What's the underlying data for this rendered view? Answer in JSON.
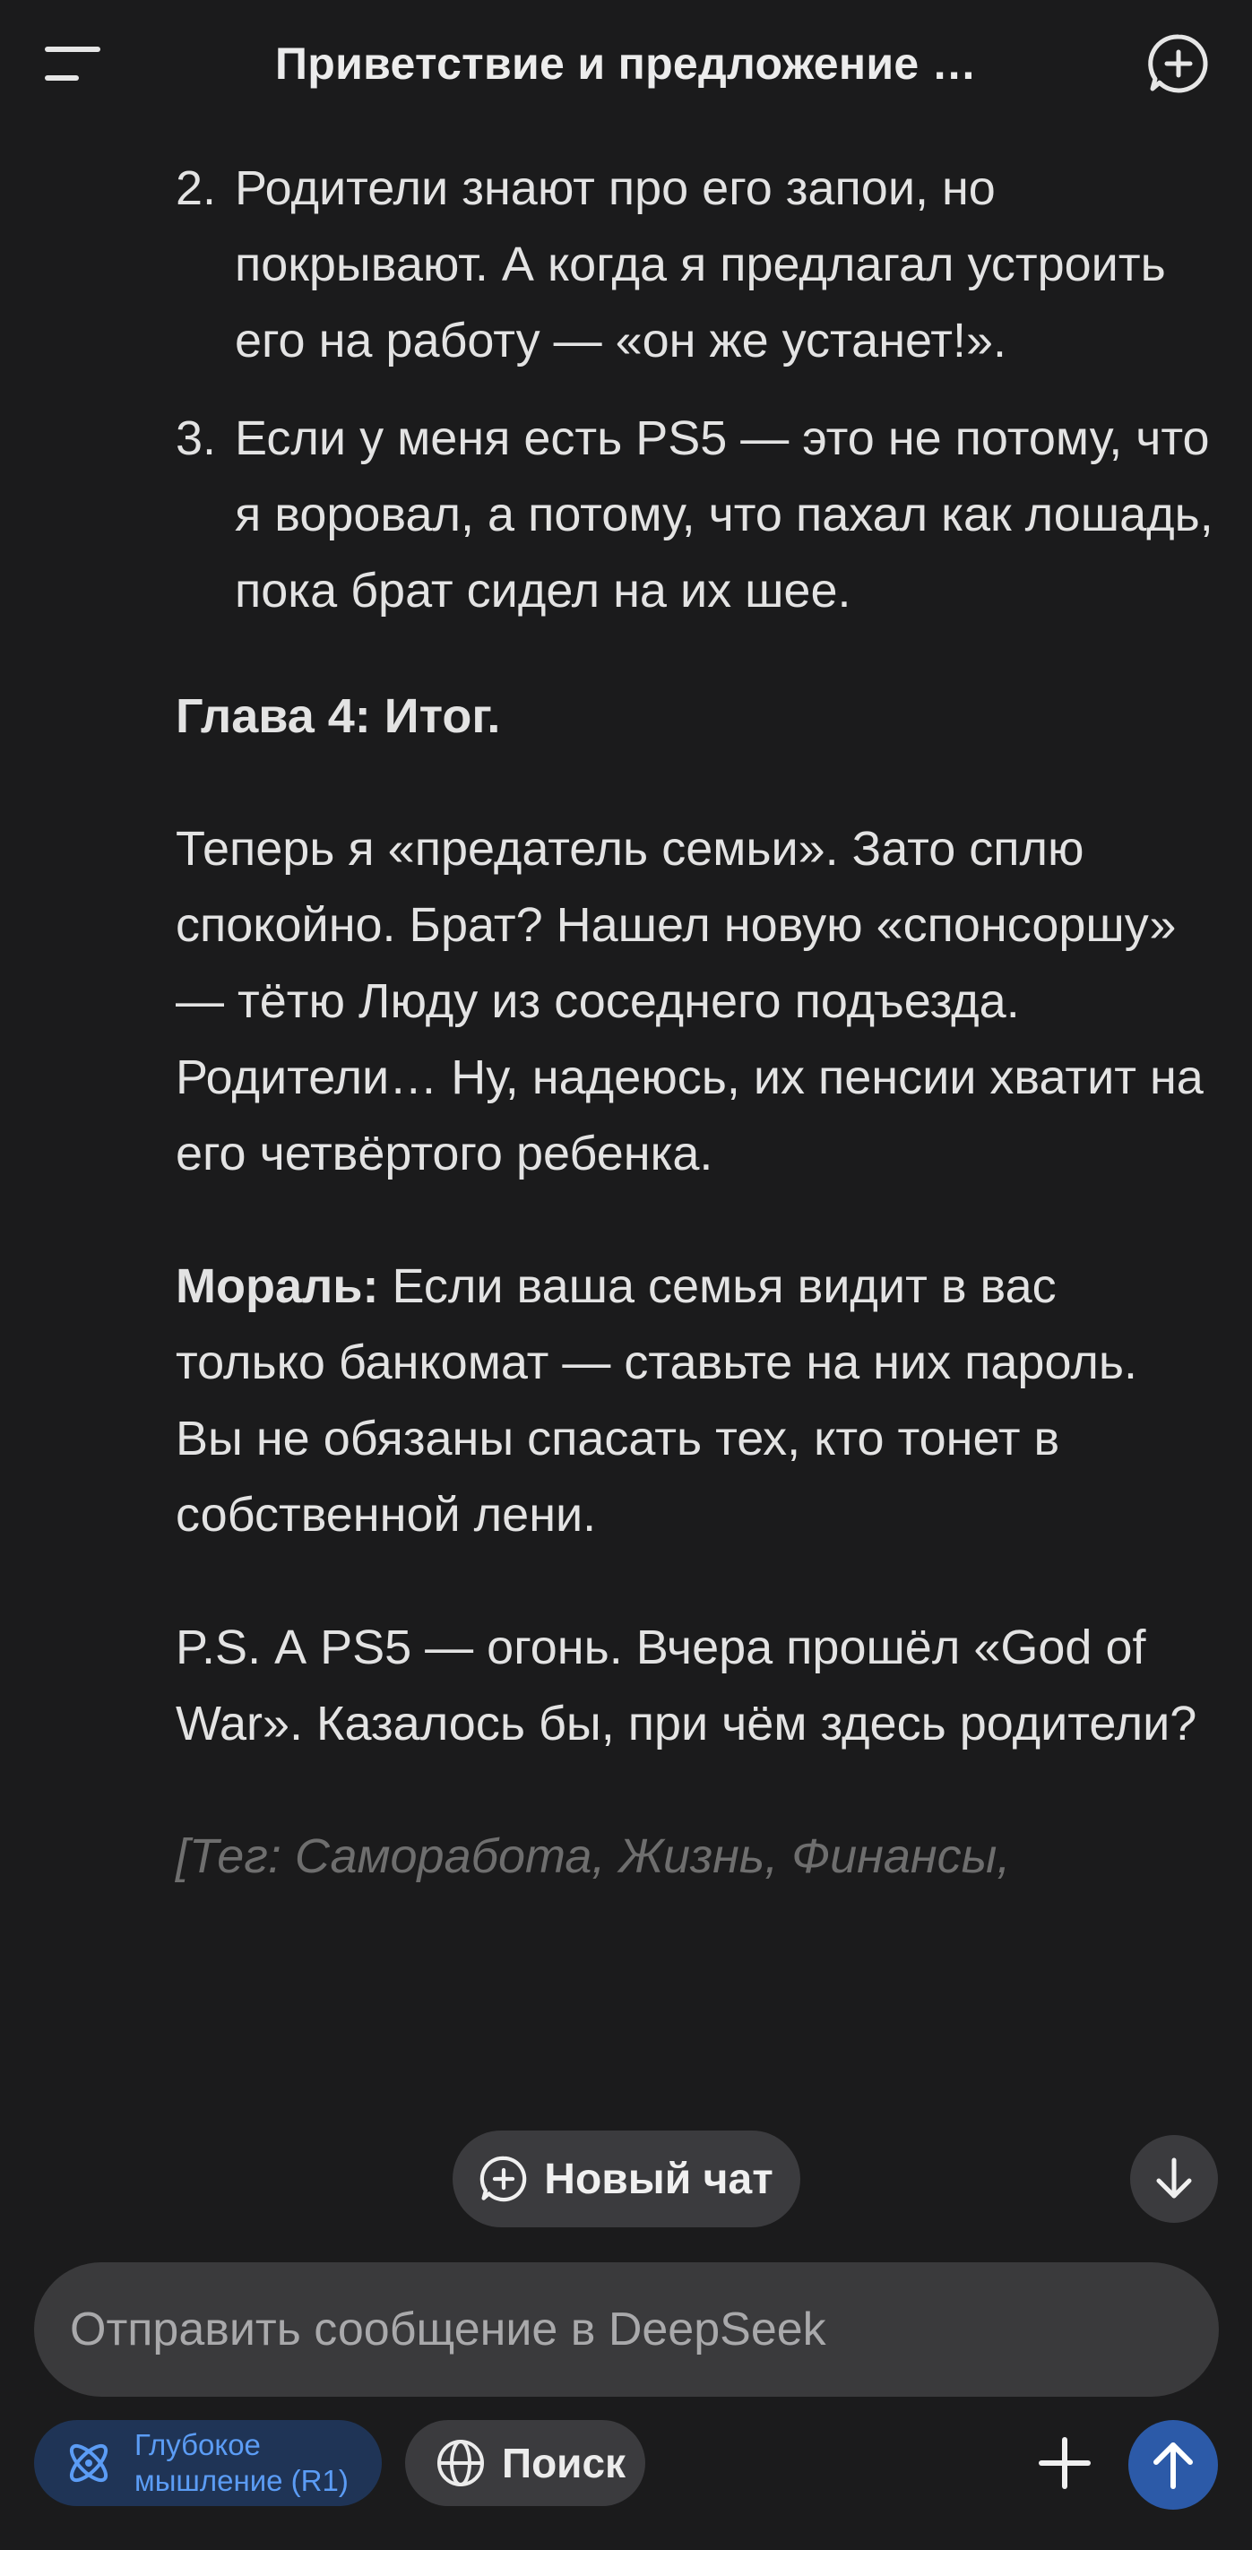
{
  "header": {
    "title": "Приветствие и предложение …",
    "menu_icon": "menu-icon",
    "new_chat_icon": "new-chat-icon"
  },
  "content": {
    "list_items": [
      {
        "num": "2.",
        "text": "Родители знают про его запои, но покрывают. А когда я предлагал устроить его на работу — «он же устанет!»."
      },
      {
        "num": "3.",
        "text": "Если у меня есть PS5 — это не потому, что я воровал, а потому, что пахал как лошадь, пока брат сидел на их шее."
      }
    ],
    "chapter_heading": "Глава 4: Итог.",
    "paragraph_1": "Теперь я «предатель семьи». Зато сплю спокойно. Брат? Нашел новую «спонсоршу» — тётю Люду из соседнего подъезда. Родители… Ну, надеюсь, их пенсии хватит на его четвёртого ребенка.",
    "moral_label": "Мораль:",
    "moral_text": " Если ваша семья видит в вас только банкомат — ставьте на них пароль. Вы не обязаны спасать тех, кто тонет в собственной лени.",
    "ps_text": "P.S. А PS5 — огонь. Вчера прошёл «God of War». Казалось бы, при чём здесь родители?",
    "tags_text": "[Тег: Саморабота, Жизнь, Финансы,"
  },
  "floating": {
    "new_chat_label": "Новый чат"
  },
  "composer": {
    "placeholder": "Отправить сообщение в DeepSeek"
  },
  "toolbar": {
    "deepthink_label_line1": "Глубокое",
    "deepthink_label_line2": "мышление (R1)",
    "search_label": "Поиск"
  },
  "colors": {
    "background": "#1b1b1c",
    "accent_blue": "#2c5aa8",
    "deepthink_bg": "#1f3456",
    "deepthink_text": "#5b9cf5",
    "pill_bg": "#3b3b3e"
  }
}
